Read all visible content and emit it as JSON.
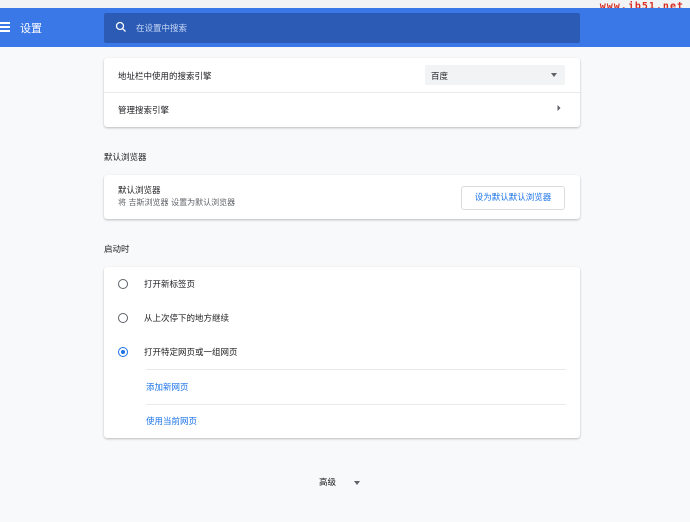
{
  "watermark": "www.jb51.net",
  "header": {
    "title": "设置",
    "search_placeholder": "在设置中搜索"
  },
  "search_engine": {
    "row_label": "地址栏中使用的搜索引擎",
    "selected": "百度",
    "manage_label": "管理搜索引擎"
  },
  "default_browser": {
    "section_title": "默认浏览器",
    "label": "默认浏览器",
    "description": "将 吉斯浏览器 设置为默认浏览器",
    "button": "设为默认默认浏览器"
  },
  "startup": {
    "section_title": "启动时",
    "options": [
      {
        "label": "打开新标签页",
        "checked": false
      },
      {
        "label": "从上次停下的地方继续",
        "checked": false
      },
      {
        "label": "打开特定网页或一组网页",
        "checked": true
      }
    ],
    "add_page": "添加新网页",
    "use_current": "使用当前网页"
  },
  "advanced": "高级",
  "colors": {
    "header": "#3b78e7",
    "search_box": "#2b5bb5",
    "accent": "#1a73e8"
  }
}
